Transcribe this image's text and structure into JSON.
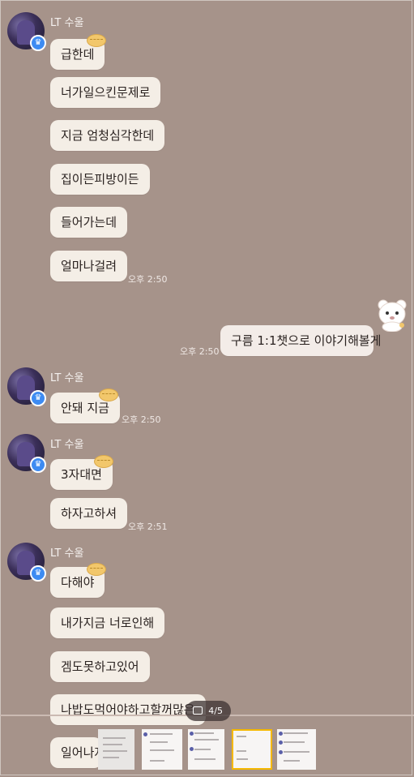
{
  "chat": {
    "sender_name": "LT 수울",
    "groups": [
      {
        "messages": [
          "급한데",
          "너가일으킨문제로",
          "지금 엄청심각한데",
          "집이든피방이든",
          "들어가는데",
          "얼마나걸려"
        ],
        "time": "오후 2:50"
      },
      {
        "messages": [
          "안돼 지금"
        ],
        "time": "오후 2:50"
      },
      {
        "messages": [
          "3자대면",
          "하자고하셔"
        ],
        "time": "오후 2:51"
      },
      {
        "messages": [
          "다해야",
          "내가지금 너로인해",
          "겜도못하고있어",
          "나밥도먹어야하고할꺼많은",
          "일어나자"
        ]
      }
    ],
    "my_message": {
      "text": "구름 1:1챗으로 이야기해볼게",
      "time": "오후 2:50"
    }
  },
  "viewer": {
    "counter": "4/5"
  },
  "icons": {
    "avatar_badge": "crown-icon",
    "sticker": "bear-sticker-icon",
    "counter_icon": "image-icon"
  },
  "colors": {
    "background": "#a6938a",
    "bubble": "#f4eee6",
    "badge": "#3d8bf2",
    "thumbnail_highlight": "#f5b800"
  }
}
